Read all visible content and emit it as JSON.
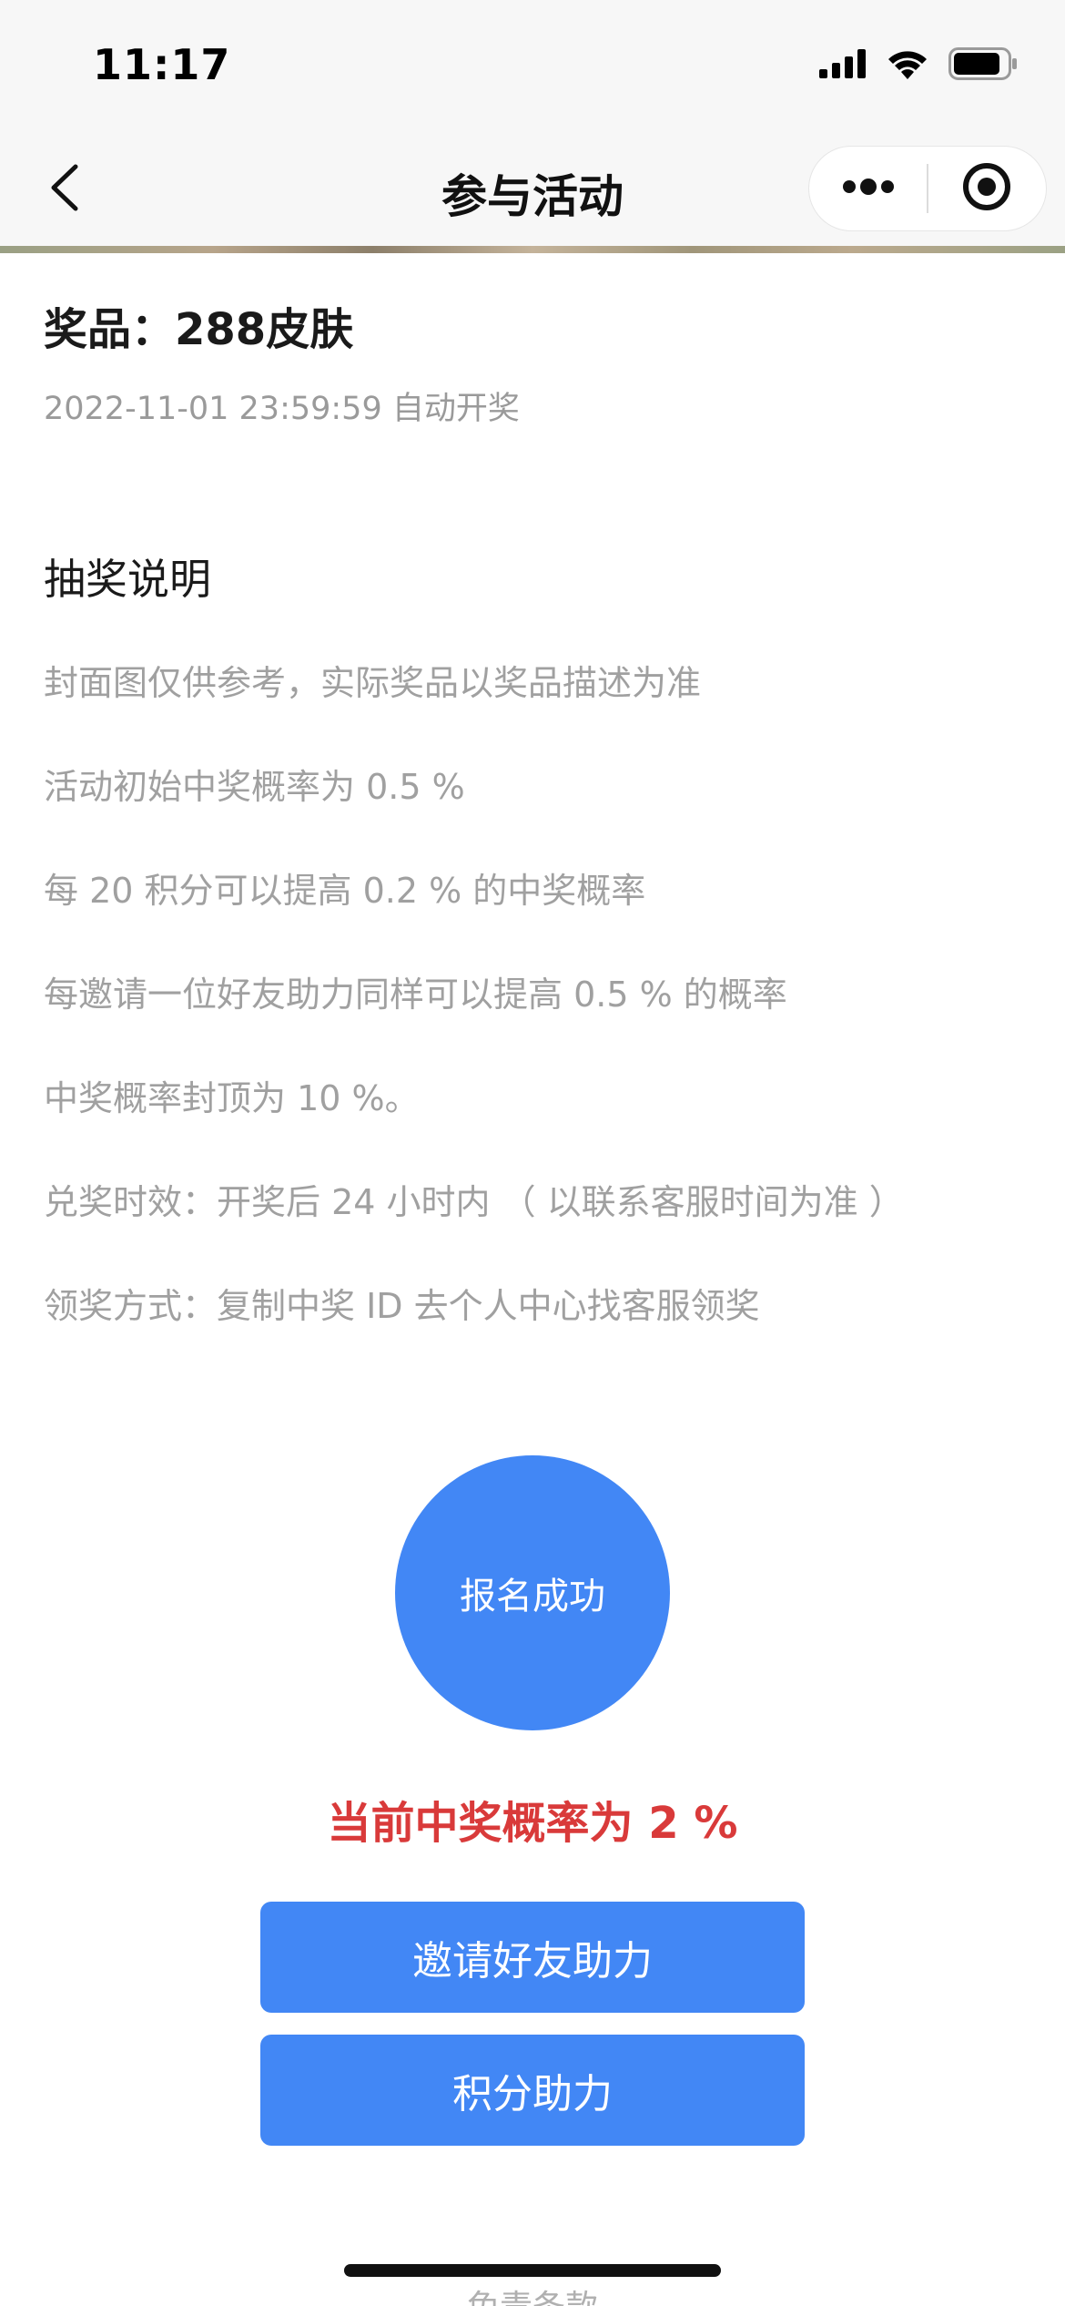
{
  "status_bar": {
    "time": "11:17"
  },
  "nav": {
    "title": "参与活动"
  },
  "prize": {
    "title": "奖品：288皮肤",
    "draw_time": "2022-11-01 23:59:59 自动开奖"
  },
  "rules": {
    "title": "抽奖说明",
    "lines": [
      "封面图仅供参考，实际奖品以奖品描述为准",
      "活动初始中奖概率为 0.5 %",
      "每 20 积分可以提高 0.2 % 的中奖概率",
      "每邀请一位好友助力同样可以提高 0.5 % 的概率",
      "中奖概率封顶为 10 %。",
      "兑奖时效：开奖后 24 小时内 （ 以联系客服时间为准 ）",
      "领奖方式：复制中奖 ID 去个人中心找客服领奖"
    ]
  },
  "signup": {
    "label": "报名成功"
  },
  "probability_text": "当前中奖概率为 2 %",
  "buttons": {
    "invite": "邀请好友助力",
    "points": "积分助力"
  },
  "footer": {
    "disclaimer": "免责条款"
  },
  "colors": {
    "accent": "#4287f5",
    "probability": "#d93a3a"
  },
  "icons": {
    "back": "chevron-left-icon",
    "more": "more-dots-icon",
    "close": "target-close-icon",
    "signal": "signal-icon",
    "wifi": "wifi-icon",
    "battery": "battery-icon"
  }
}
